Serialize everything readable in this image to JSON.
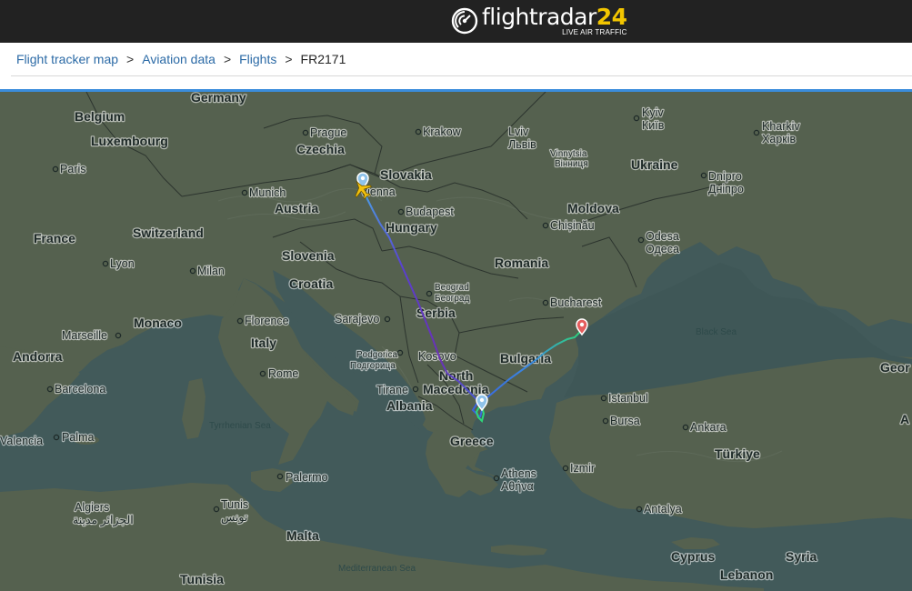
{
  "header": {
    "logo_text_main": "flightradar",
    "logo_text_accent": "24",
    "logo_tagline": "LIVE AIR TRAFFIC"
  },
  "breadcrumb": {
    "items": [
      {
        "label": "Flight tracker map"
      },
      {
        "label": "Aviation data"
      },
      {
        "label": "Flights"
      }
    ],
    "separator": ">",
    "current": "FR2171"
  },
  "map": {
    "countries": [
      "Germany",
      "Belgium",
      "Luxembourg",
      "France",
      "Czechia",
      "Slovakia",
      "Austria",
      "Switzerland",
      "Hungary",
      "Slovenia",
      "Croatia",
      "Monaco",
      "Italy",
      "Andorra",
      "Serbia",
      "Kosovo",
      "North",
      "Macedonia",
      "Albania",
      "Bulgaria",
      "Greece",
      "Romania",
      "Moldova",
      "Ukraine",
      "Türkiye",
      "Malta",
      "Tunisia",
      "Cyprus",
      "Syria",
      "Lebanon",
      "Geor",
      "A"
    ],
    "cities": [
      "Paris",
      "Munich",
      "Prague",
      "Krakow",
      "Lviv",
      "Львів",
      "Kyiv",
      "Київ",
      "Kharkiv",
      "Харків",
      "Vinnytsia",
      "Вінниця",
      "Dnipro",
      "Дніпро",
      "Vienna",
      "Budapest",
      "Chișinău",
      "Odesa",
      "Одеса",
      "Lyon",
      "Milan",
      "Beograd",
      "Београд",
      "Bucharest",
      "Marseille",
      "Florence",
      "Sarajevo",
      "Rome",
      "Podgorica",
      "Подгорица",
      "Tirane",
      "Barcelona",
      "Valencia",
      "Palma",
      "Istanbul",
      "Bursa",
      "Ankara",
      "Izmir",
      "Athens",
      "Αθήνα",
      "Antalya",
      "Palermo",
      "Algiers",
      "الجزائر مدينة",
      "Tunis",
      "تونس"
    ],
    "seas": [
      "Black Sea",
      "Tyrrhenian Sea",
      "Mediterranean Sea"
    ],
    "colors": {
      "sea": "#425a5a",
      "land": "#55614f",
      "route_start": "#4aa3e8",
      "route_mid": "#6b2fb5",
      "route_end": "#2fd67a",
      "origin_pin": "#8fc3ea",
      "dest_pin": "#e45d5d",
      "aircraft": "#f4c20d"
    }
  }
}
